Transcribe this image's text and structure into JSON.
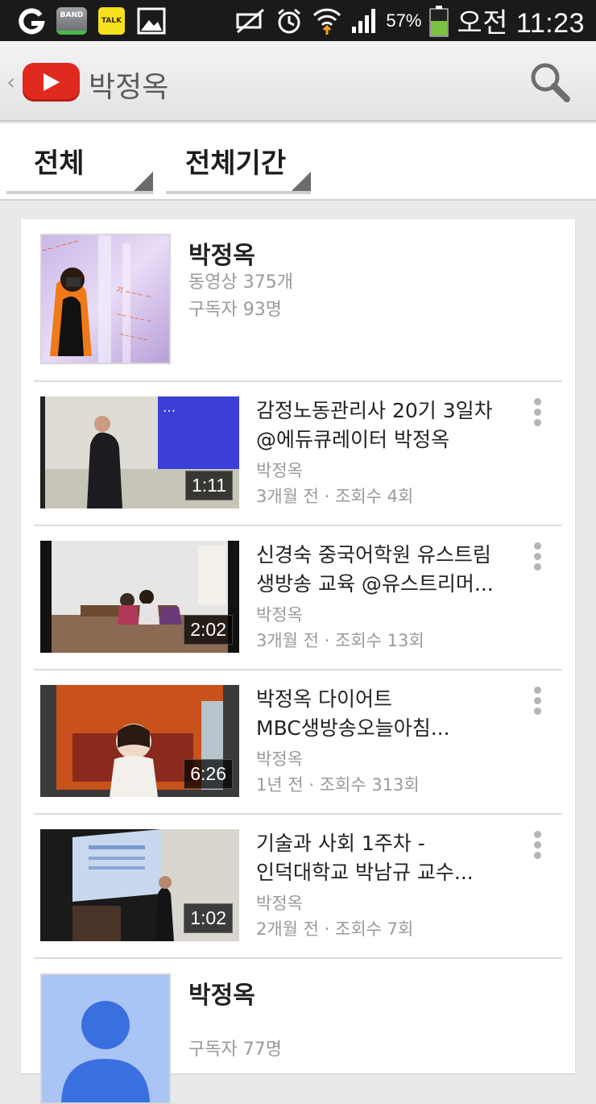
{
  "status_bar": {
    "band_label": "BAND",
    "talk_label": "TALK",
    "battery_percent": "57%",
    "time": "오전 11:23"
  },
  "action_bar": {
    "title": "박정옥"
  },
  "filters": {
    "type": "전체",
    "period": "전체기간"
  },
  "channel_top": {
    "name": "박정옥",
    "videos": "동영상 375개",
    "subscribers": "구독자 93명"
  },
  "videos": [
    {
      "title_line1": "감정노동관리사 20기 3일차",
      "title_line2": "@에듀큐레이터 박정옥",
      "channel": "박정옥",
      "meta": "3개월 전 · 조회수 4회",
      "duration": "1:11"
    },
    {
      "title_line1": "신경숙 중국어학원 유스트림",
      "title_line2": "생방송 교육 @유스트리머...",
      "channel": "박정옥",
      "meta": "3개월 전 · 조회수 13회",
      "duration": "2:02"
    },
    {
      "title_line1": "박정옥 다이어트",
      "title_line2": "MBC생방송오늘아침...",
      "channel": "박정옥",
      "meta": "1년 전 · 조회수 313회",
      "duration": "6:26"
    },
    {
      "title_line1": "기술과 사회 1주차 -",
      "title_line2": "인덕대학교 박남규 교수...",
      "channel": "박정옥",
      "meta": "2개월 전 · 조회수 7회",
      "duration": "1:02"
    }
  ],
  "channel_bottom": {
    "name": "박정옥",
    "subscribers": "구독자 77명"
  },
  "colors": {
    "youtube_red": "#e02a20",
    "status_bar_bg": "#1a1a1a",
    "battery_green": "#7cc142"
  }
}
